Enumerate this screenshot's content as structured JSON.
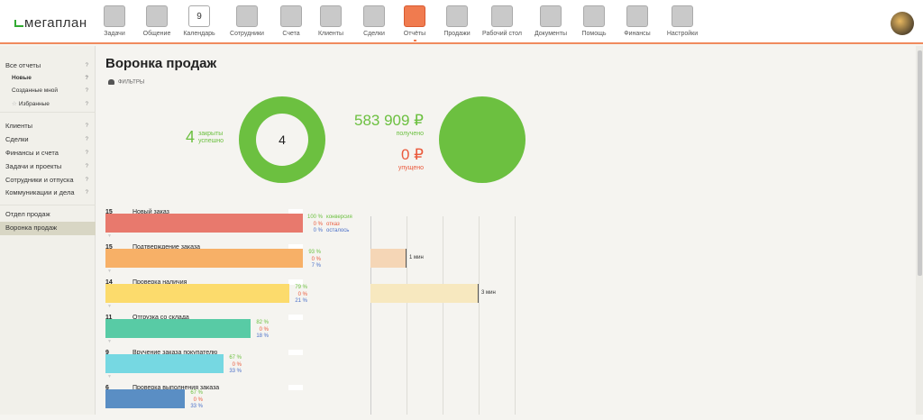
{
  "header": {
    "logo": "мегаплан",
    "nav": [
      {
        "label": "Задачи",
        "icon": "tasks-icon"
      },
      {
        "label": "Общение",
        "icon": "chat-icon"
      },
      {
        "label": "Календарь",
        "icon": "calendar-icon",
        "day": "9"
      },
      {
        "label": "Сотрудники",
        "icon": "employees-icon"
      },
      {
        "label": "Счета",
        "icon": "invoice-icon"
      },
      {
        "label": "Клиенты",
        "icon": "clients-icon"
      },
      {
        "label": "Сделки",
        "icon": "briefcase-icon"
      },
      {
        "label": "Отчёты",
        "icon": "reports-icon",
        "active": true
      },
      {
        "label": "Продажи",
        "icon": "dollar-icon"
      },
      {
        "label": "Рабочий стол",
        "icon": "dashboard-icon"
      },
      {
        "label": "Документы",
        "icon": "folder-icon"
      },
      {
        "label": "Помощь",
        "icon": "lifebuoy-icon"
      },
      {
        "label": "Финансы",
        "icon": "safe-icon"
      },
      {
        "label": "Настройки",
        "icon": "gear-icon"
      }
    ]
  },
  "sidebar": {
    "items": [
      {
        "label": "Все отчеты",
        "q": "?"
      },
      {
        "label": "Новые",
        "q": "?"
      },
      {
        "label": "Созданные мной",
        "q": "?"
      },
      {
        "label": "Избранные",
        "q": "?"
      },
      {
        "label": "Клиенты",
        "q": "?"
      },
      {
        "label": "Сделки",
        "q": "?"
      },
      {
        "label": "Финансы и счета",
        "q": "?"
      },
      {
        "label": "Задачи и проекты",
        "q": "?"
      },
      {
        "label": "Сотрудники и отпуска",
        "q": "?"
      },
      {
        "label": "Коммуникации и дела",
        "q": "?"
      },
      {
        "label": "Отдел продаж"
      },
      {
        "label": "Воронка продаж"
      }
    ]
  },
  "main": {
    "title": "Воронка продаж",
    "filters": "ФИЛЬТРЫ",
    "closed": {
      "value": "4",
      "label1": "закрыты",
      "label2": "успешно",
      "donut_center": "4"
    },
    "received": {
      "value": "583 909 ₽",
      "label": "получено"
    },
    "lost": {
      "value": "0 ₽",
      "label": "упущено"
    },
    "colors": {
      "green": "#6cc040",
      "red": "#ea5a3c",
      "blue": "#4a6fc8"
    }
  },
  "funnel": {
    "max": 15,
    "stages": [
      {
        "count": 15,
        "name": "Новый заказ",
        "conv": "100 %",
        "refuse": "0 %",
        "left": "0 %",
        "conv_l": "конверсия",
        "refuse_l": "отказ",
        "left_l": "осталось",
        "color": "#e8796d"
      },
      {
        "count": 15,
        "name": "Подтверждение заказа",
        "conv": "93 %",
        "refuse": "0 %",
        "left": "7 %",
        "color": "#f7b067",
        "time_min": 1,
        "time": "1 мин",
        "tcolor": "#f5d6b6"
      },
      {
        "count": 14,
        "name": "Проверка наличия",
        "conv": "79 %",
        "refuse": "0 %",
        "left": "21 %",
        "color": "#fcdb6c",
        "time_min": 3,
        "time": "3 мин",
        "tcolor": "#f7e8bf"
      },
      {
        "count": 11,
        "name": "Отгрузка со склада",
        "conv": "82 %",
        "refuse": "0 %",
        "left": "18 %",
        "color": "#58cba5"
      },
      {
        "count": 9,
        "name": "Вручение заказа покупателю",
        "conv": "67 %",
        "refuse": "0 %",
        "left": "33 %",
        "color": "#76d8e2"
      },
      {
        "count": 6,
        "name": "Проверка выполнения заказа",
        "conv": "67 %",
        "refuse": "0 %",
        "left": "33 %",
        "color": "#5a8ec4"
      }
    ]
  }
}
